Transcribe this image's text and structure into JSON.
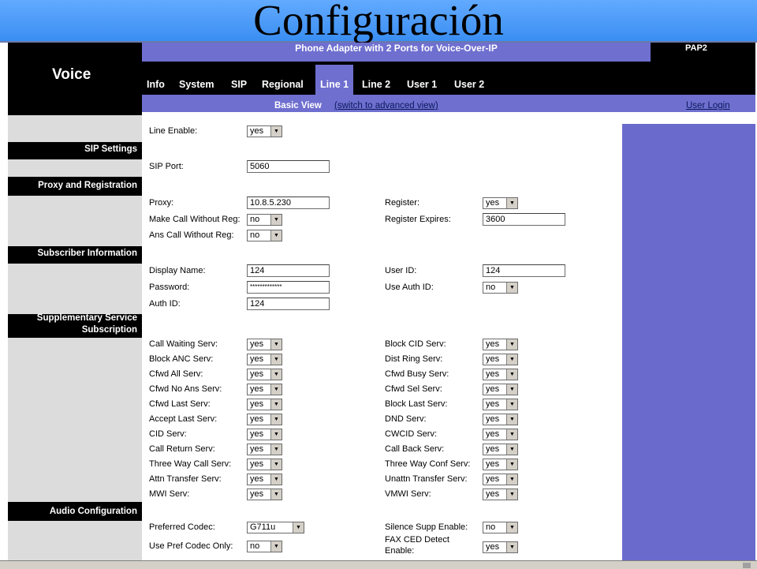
{
  "slide_title": "Configuración",
  "header": {
    "brand": "Voice",
    "product": "Phone Adapter with 2 Ports for Voice-Over-IP",
    "model": "PAP2"
  },
  "tabs": [
    {
      "label": "Info",
      "active": false
    },
    {
      "label": "System",
      "active": false
    },
    {
      "label": "SIP",
      "active": false
    },
    {
      "label": "Regional",
      "active": false
    },
    {
      "label": "Line 1",
      "active": true
    },
    {
      "label": "Line 2",
      "active": false
    },
    {
      "label": "User 1",
      "active": false
    },
    {
      "label": "User 2",
      "active": false
    }
  ],
  "viewbar": {
    "basic_view": "Basic View",
    "switch_link": "(switch to advanced view)",
    "user_login": "User Login"
  },
  "sections": {
    "sip_settings": "SIP Settings",
    "proxy_registration": "Proxy and Registration",
    "subscriber_info": "Subscriber Information",
    "supplementary_1": "Supplementary Service",
    "supplementary_2": "Subscription",
    "audio_config": "Audio Configuration"
  },
  "fields": {
    "line_enable": {
      "label": "Line Enable:",
      "value": "yes"
    },
    "sip_port": {
      "label": "SIP Port:",
      "value": "5060"
    },
    "proxy": {
      "label": "Proxy:",
      "value": "10.8.5.230"
    },
    "register": {
      "label": "Register:",
      "value": "yes"
    },
    "make_call_without_reg": {
      "label": "Make Call Without Reg:",
      "value": "no"
    },
    "register_expires": {
      "label": "Register Expires:",
      "value": "3600"
    },
    "ans_call_without_reg": {
      "label": "Ans Call Without Reg:",
      "value": "no"
    },
    "display_name": {
      "label": "Display Name:",
      "value": "124"
    },
    "user_id": {
      "label": "User ID:",
      "value": "124"
    },
    "password": {
      "label": "Password:",
      "value": "*************"
    },
    "use_auth_id": {
      "label": "Use Auth ID:",
      "value": "no"
    },
    "auth_id": {
      "label": "Auth ID:",
      "value": "124"
    },
    "preferred_codec": {
      "label": "Preferred Codec:",
      "value": "G711u"
    },
    "silence_supp_enable": {
      "label": "Silence Supp Enable:",
      "value": "no"
    },
    "use_pref_codec_only": {
      "label": "Use Pref Codec Only:",
      "value": "no"
    },
    "fax_ced_detect_1": "FAX CED Detect",
    "fax_ced_detect_2": "Enable:",
    "fax_ced_detect_value": "yes"
  },
  "services_left": [
    {
      "label": "Call Waiting Serv:",
      "value": "yes"
    },
    {
      "label": "Block ANC Serv:",
      "value": "yes"
    },
    {
      "label": "Cfwd All Serv:",
      "value": "yes"
    },
    {
      "label": "Cfwd No Ans Serv:",
      "value": "yes"
    },
    {
      "label": "Cfwd Last Serv:",
      "value": "yes"
    },
    {
      "label": "Accept Last Serv:",
      "value": "yes"
    },
    {
      "label": "CID Serv:",
      "value": "yes"
    },
    {
      "label": "Call Return Serv:",
      "value": "yes"
    },
    {
      "label": "Three Way Call Serv:",
      "value": "yes"
    },
    {
      "label": "Attn Transfer Serv:",
      "value": "yes"
    },
    {
      "label": "MWI Serv:",
      "value": "yes"
    }
  ],
  "services_right": [
    {
      "label": "Block CID Serv:",
      "value": "yes"
    },
    {
      "label": "Dist Ring Serv:",
      "value": "yes"
    },
    {
      "label": "Cfwd Busy Serv:",
      "value": "yes"
    },
    {
      "label": "Cfwd Sel Serv:",
      "value": "yes"
    },
    {
      "label": "Block Last Serv:",
      "value": "yes"
    },
    {
      "label": "DND Serv:",
      "value": "yes"
    },
    {
      "label": "CWCID Serv:",
      "value": "yes"
    },
    {
      "label": "Call Back Serv:",
      "value": "yes"
    },
    {
      "label": "Three Way Conf Serv:",
      "value": "yes"
    },
    {
      "label": "Unattn Transfer Serv:",
      "value": "yes"
    },
    {
      "label": "VMWI Serv:",
      "value": "yes"
    }
  ],
  "colors": {
    "accent": "#6f6fd0",
    "title_bar": "#3a8ef2",
    "panel_black": "#000000"
  }
}
